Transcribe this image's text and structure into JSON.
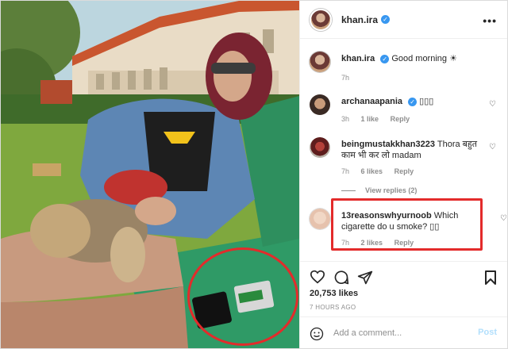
{
  "post": {
    "username": "khan.ira",
    "verified_icon": "verified-badge-icon",
    "more_icon": "more-options-icon"
  },
  "caption": {
    "username": "khan.ira",
    "text": "Good morning",
    "emoji_icon": "sun-emoji-icon",
    "time": "7h"
  },
  "comments": [
    {
      "username": "archanaapania",
      "verified": true,
      "text": "▯▯▯",
      "time": "3h",
      "likes": "1 like",
      "reply": "Reply"
    },
    {
      "username": "beingmustakkhan3223",
      "verified": false,
      "text": "Thora बहुत काम भी कर लो madam",
      "time": "7h",
      "likes": "6 likes",
      "reply": "Reply"
    },
    {
      "username": "13reasonswhyurnoob",
      "verified": false,
      "text": "Which cigarette do u smoke? ▯▯",
      "time": "7h",
      "likes": "2 likes",
      "reply": "Reply"
    }
  ],
  "view_replies": "View replies (2)",
  "stats": {
    "likes": "20,753 likes",
    "posted": "7 HOURS AGO"
  },
  "add_comment": {
    "placeholder": "Add a comment...",
    "post_label": "Post"
  },
  "colors": {
    "accent_blue": "#3897f0",
    "highlight_red": "#e32b2b",
    "muted_text": "#8e8e8e"
  }
}
